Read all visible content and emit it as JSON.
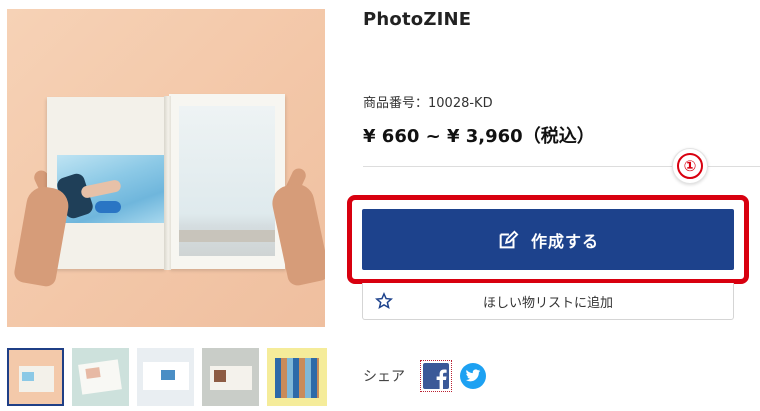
{
  "product": {
    "title": "PhotoZINE",
    "number_label": "商品番号：10028-KD",
    "price": "¥ 660 ~ ¥ 3,960（税込）"
  },
  "annotation": {
    "step": "①",
    "highlight_color": "#d8000f"
  },
  "actions": {
    "create_label": "作成する",
    "create_icon": "edit-icon",
    "wishlist_label": "ほしい物リストに追加",
    "wishlist_icon": "star-outline-icon"
  },
  "share": {
    "label": "シェア",
    "networks": [
      "facebook-icon",
      "twitter-icon"
    ]
  },
  "gallery": {
    "thumbnail_count": 5,
    "active_index": 0
  },
  "colors": {
    "primary_button": "#1d428c",
    "facebook": "#3b5998",
    "twitter": "#1da1f2"
  }
}
